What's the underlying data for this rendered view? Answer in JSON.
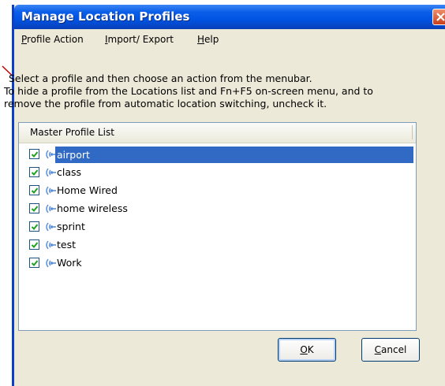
{
  "window": {
    "title": "Manage Location Profiles"
  },
  "menubar": {
    "items": [
      {
        "label_mn": "P",
        "label_rest": "rofile Action"
      },
      {
        "label_mn": "I",
        "label_rest": "mport/ Export"
      },
      {
        "label_mn": "H",
        "label_rest": "elp"
      }
    ]
  },
  "instructions": {
    "line1": "Select a profile and then choose an action from the menubar.",
    "line2": "To hide a profile from the Locations list and Fn+F5 on-screen menu, and to",
    "line3": "remove the profile from automatic location switching, uncheck it."
  },
  "list": {
    "header": "Master Profile List",
    "items": [
      {
        "label": "airport",
        "checked": true,
        "selected": true,
        "icon": "wireless-signal-icon"
      },
      {
        "label": "class",
        "checked": true,
        "selected": false,
        "icon": "wireless-signal-icon"
      },
      {
        "label": "Home Wired",
        "checked": true,
        "selected": false,
        "icon": "wireless-signal-icon"
      },
      {
        "label": "home wireless",
        "checked": true,
        "selected": false,
        "icon": "wireless-signal-icon"
      },
      {
        "label": "sprint",
        "checked": true,
        "selected": false,
        "icon": "wireless-signal-icon"
      },
      {
        "label": "test",
        "checked": true,
        "selected": false,
        "icon": "wireless-signal-icon"
      },
      {
        "label": "Work",
        "checked": true,
        "selected": false,
        "icon": "wireless-signal-icon"
      }
    ]
  },
  "buttons": {
    "ok_mn": "O",
    "ok_rest": "K",
    "cancel_mn": "C",
    "cancel_rest": "ancel"
  },
  "colors": {
    "titlebar": "#0054e3",
    "selection": "#316ac5",
    "annotation_arrow": "#c00000"
  }
}
